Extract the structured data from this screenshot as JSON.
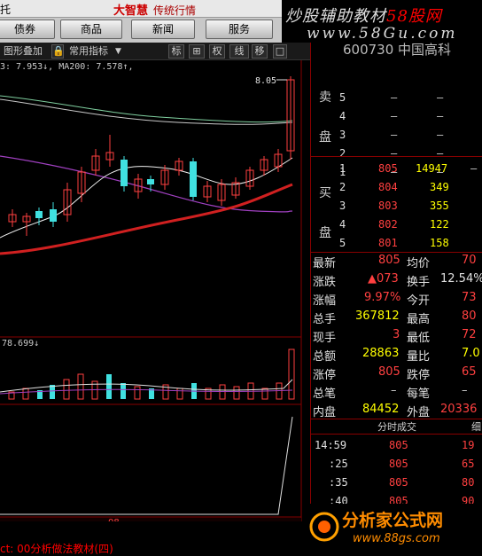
{
  "header": {
    "left_label": "托",
    "logo_main": "大智慧",
    "logo_sub": "传统行情",
    "nav": [
      "债券",
      "商品",
      "新闻",
      "服务"
    ],
    "watermark_line1_a": "炒股辅助教材",
    "watermark_line1_b": "58股网",
    "watermark_line2": "www.58Gu.com"
  },
  "toolbar": {
    "overlay_label": "图形叠加",
    "indicator_label": "常用指标",
    "btn_biao": "标",
    "btn_plus": "⊞",
    "btn_quan": "权",
    "btn_xian": "线",
    "btn_yi": "移"
  },
  "chart": {
    "ma_text": "3: 7.953↓, MA200: 7.578↑,",
    "peak_label": "8.05",
    "vol_label": "78.699↓",
    "bottom_date": "08",
    "bottom_red_text": "ct: 00分析做法教材(四)"
  },
  "quote": {
    "title": "600730 中国高科",
    "sell_label": "卖盘",
    "buy_label": "买盘",
    "sell": [
      {
        "lvl": "5",
        "price": "–",
        "vol": "–"
      },
      {
        "lvl": "4",
        "price": "–",
        "vol": "–"
      },
      {
        "lvl": "3",
        "price": "–",
        "vol": "–"
      },
      {
        "lvl": "2",
        "price": "–",
        "vol": "–"
      },
      {
        "lvl": "1",
        "price": "–",
        "vol": "–"
      }
    ],
    "buy": [
      {
        "lvl": "1",
        "price": "805",
        "vol": "14947",
        "extra": "–"
      },
      {
        "lvl": "2",
        "price": "804",
        "vol": "349"
      },
      {
        "lvl": "3",
        "price": "803",
        "vol": "355"
      },
      {
        "lvl": "4",
        "price": "802",
        "vol": "122"
      },
      {
        "lvl": "5",
        "price": "801",
        "vol": "158"
      }
    ]
  },
  "stats": [
    {
      "k1": "最新",
      "v1": "805",
      "k2": "均价",
      "v2": "70"
    },
    {
      "k1": "涨跌",
      "v1": "▲073",
      "k2": "换手",
      "v2": "12.54%"
    },
    {
      "k1": "涨幅",
      "v1": "9.97%",
      "k2": "今开",
      "v2": "73"
    },
    {
      "k1": "总手",
      "v1": "367812",
      "k2": "最高",
      "v2": "80"
    },
    {
      "k1": "现手",
      "v1": "3",
      "k2": "最低",
      "v2": "72"
    },
    {
      "k1": "总额",
      "v1": "28863",
      "k2": "量比",
      "v2": "7.0"
    },
    {
      "k1": "涨停",
      "v1": "805",
      "k2": "跌停",
      "v2": "65"
    },
    {
      "k1": "总笔",
      "v1": "–",
      "k2": "每笔",
      "v2": "–"
    },
    {
      "k1": "内盘",
      "v1": "84452",
      "k2": "外盘",
      "v2": "20336"
    }
  ],
  "ticks": {
    "head": "分时成交",
    "head2": "细",
    "rows": [
      {
        "time": "14:59",
        "price": "805",
        "vol": "19"
      },
      {
        "time": ":25",
        "price": "805",
        "vol": "65"
      },
      {
        "time": ":35",
        "price": "805",
        "vol": "80"
      },
      {
        "time": ":40",
        "price": "805",
        "vol": "90"
      }
    ]
  },
  "footer_logo": {
    "name": "分析家公式网",
    "url": "www.88gs.com"
  }
}
